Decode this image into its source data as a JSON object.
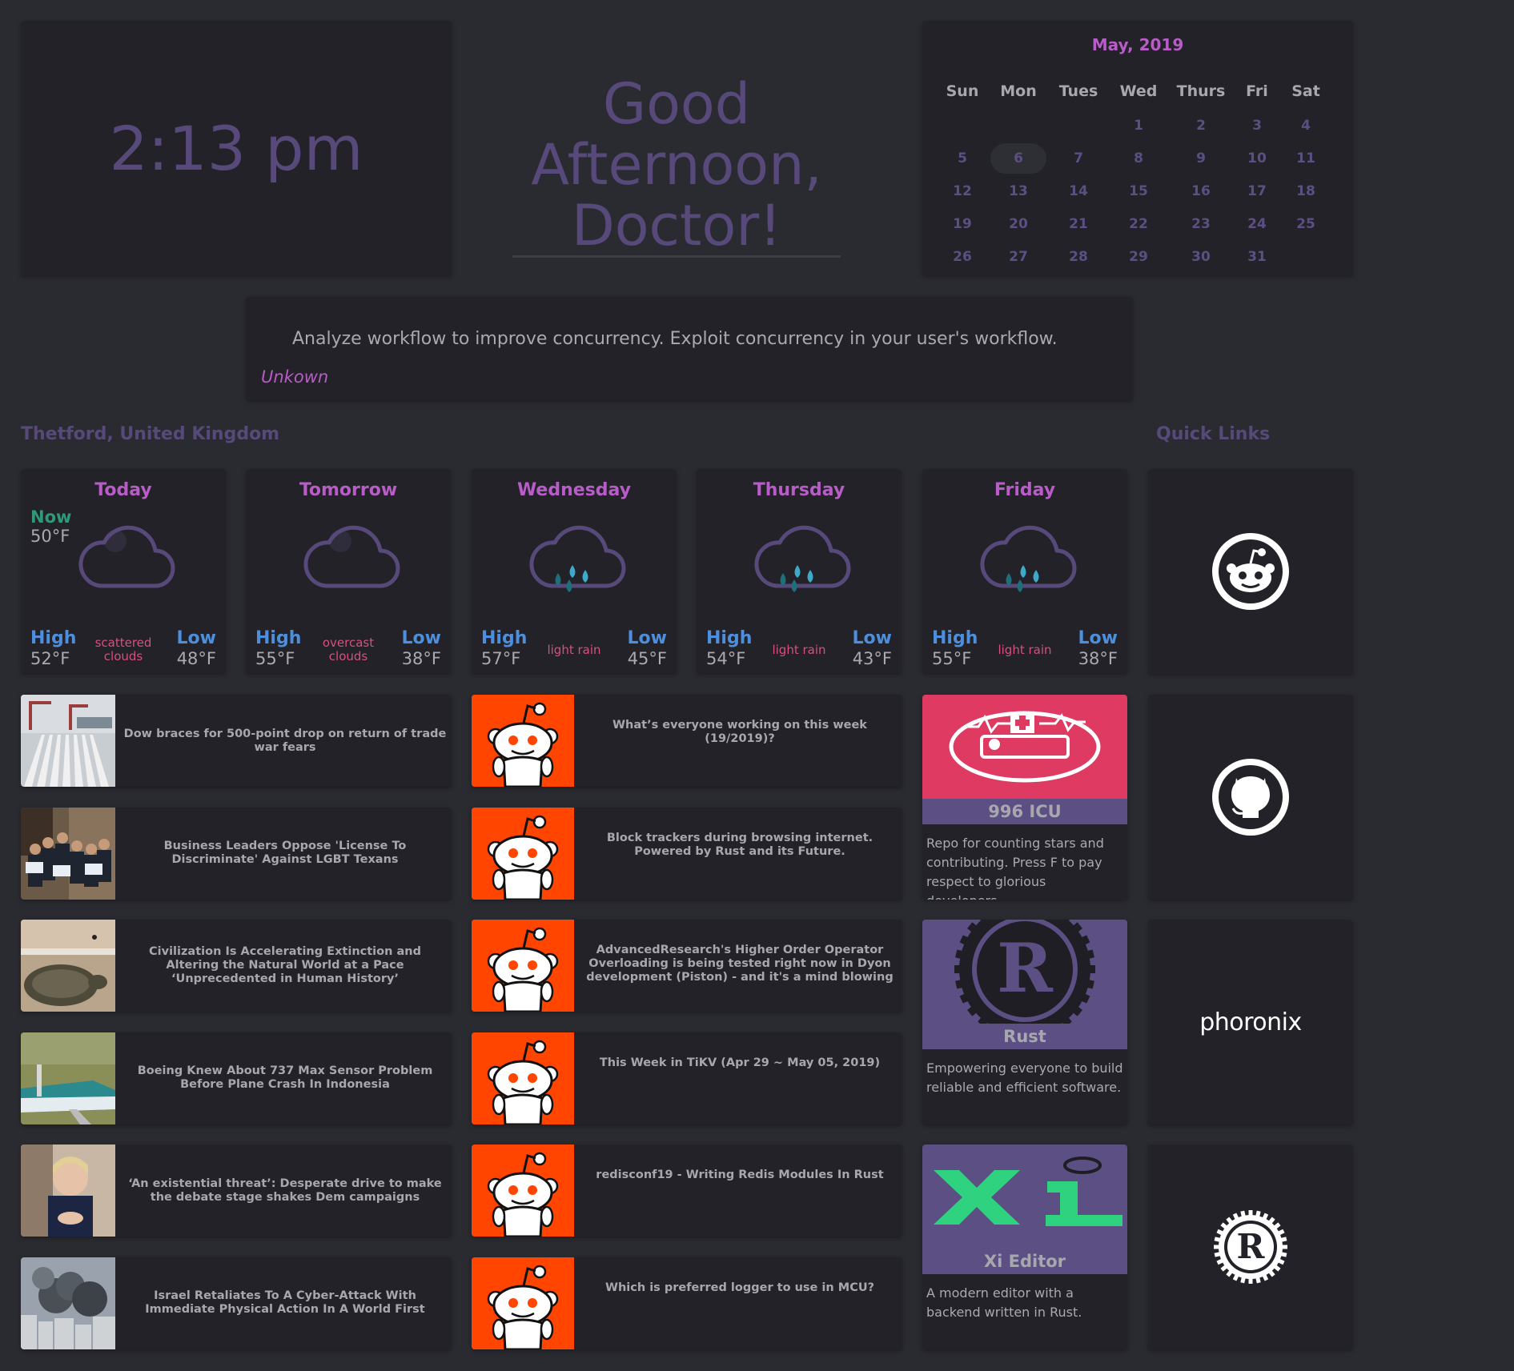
{
  "clock": {
    "time": "2:13 pm"
  },
  "greeting": {
    "line1": "Good Afternoon,",
    "line2": "Doctor!"
  },
  "calendar": {
    "title": "May, 2019",
    "headers": [
      "Sun",
      "Mon",
      "Tues",
      "Wed",
      "Thurs",
      "Fri",
      "Sat"
    ],
    "weeks": [
      [
        "",
        "",
        "",
        "1",
        "2",
        "3",
        "4"
      ],
      [
        "5",
        "6",
        "7",
        "8",
        "9",
        "10",
        "11"
      ],
      [
        "12",
        "13",
        "14",
        "15",
        "16",
        "17",
        "18"
      ],
      [
        "19",
        "20",
        "21",
        "22",
        "23",
        "24",
        "25"
      ],
      [
        "26",
        "27",
        "28",
        "29",
        "30",
        "31",
        ""
      ]
    ],
    "today": "6"
  },
  "quote": {
    "text": "Analyze workflow to improve concurrency. Exploit concurrency in your user's workflow.",
    "author": "Unkown"
  },
  "weather": {
    "location": "Thetford, United Kingdom",
    "now_label": "Now",
    "now_temp": "50°F",
    "high_label": "High",
    "low_label": "Low",
    "days": [
      {
        "day": "Today",
        "high": "52°F",
        "low": "48°F",
        "desc": "scattered clouds",
        "icon": "cloud-icon"
      },
      {
        "day": "Tomorrow",
        "high": "55°F",
        "low": "38°F",
        "desc": "overcast clouds",
        "icon": "cloud-icon"
      },
      {
        "day": "Wednesday",
        "high": "57°F",
        "low": "45°F",
        "desc": "light rain",
        "icon": "rain-cloud-icon"
      },
      {
        "day": "Thursday",
        "high": "54°F",
        "low": "43°F",
        "desc": "light rain",
        "icon": "rain-cloud-icon"
      },
      {
        "day": "Friday",
        "high": "55°F",
        "low": "38°F",
        "desc": "light rain",
        "icon": "rain-cloud-icon"
      }
    ]
  },
  "news": [
    {
      "title": "Dow braces for 500-point drop on return of trade war fears",
      "icon": "shipyard-photo"
    },
    {
      "title": "Business Leaders Oppose 'License To Discriminate' Against LGBT Texans",
      "icon": "press-conference-photo"
    },
    {
      "title": "Civilization Is Accelerating Extinction and Altering the Natural World at a Pace ‘Unprecedented in Human History’",
      "icon": "sea-turtle-photo"
    },
    {
      "title": "Boeing Knew About 737 Max Sensor Problem Before Plane Crash In Indonesia",
      "icon": "airplane-photo"
    },
    {
      "title": "‘An existential threat’: Desperate drive to make the debate stage shakes Dem campaigns",
      "icon": "politician-photo"
    },
    {
      "title": "Israel Retaliates To A Cyber-Attack With Immediate Physical Action In A World First",
      "icon": "smoke-city-photo"
    }
  ],
  "reddit": [
    {
      "title": "What’s everyone working on this week (19/2019)?"
    },
    {
      "title": "Block trackers during browsing internet. Powered by Rust and its Future."
    },
    {
      "title": "AdvancedResearch's Higher Order Operator Overloading is being tested right now in Dyon development (Piston) - and it's a mind blowing"
    },
    {
      "title": "This Week in TiKV (Apr 29 ~ May 05, 2019)"
    },
    {
      "title": "redisconf19 - Writing Redis Modules In Rust"
    },
    {
      "title": "Which is preferred logger to use in MCU?"
    }
  ],
  "repos": [
    {
      "name": "996 ICU",
      "desc": "Repo for counting stars and contributing. Press F to pay respect to glorious developers.",
      "banner_color": "#de3a62"
    },
    {
      "name": "Rust",
      "desc": "Empowering everyone to build reliable and efficient software.",
      "banner_color": "#5c4f84"
    },
    {
      "name": "Xi Editor",
      "desc": "A modern editor with a backend written in Rust.",
      "banner_color": "#5c4f84",
      "logo_text": "xi"
    }
  ],
  "quick_links": {
    "title": "Quick Links",
    "items": [
      {
        "icon": "reddit-icon"
      },
      {
        "icon": "github-icon"
      },
      {
        "icon": "phoronix-logo",
        "label": "phoronix"
      },
      {
        "icon": "rust-icon"
      }
    ]
  }
}
